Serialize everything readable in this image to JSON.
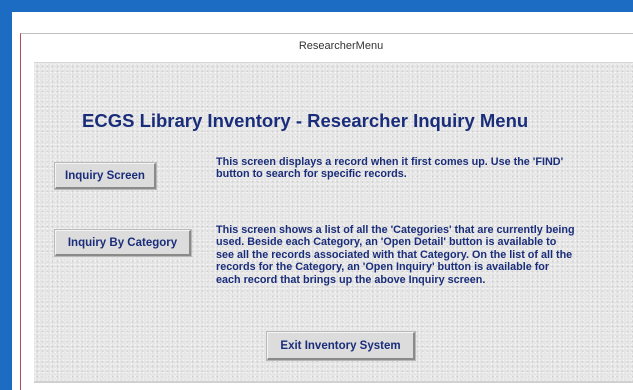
{
  "window": {
    "title": "ResearcherMenu"
  },
  "form": {
    "heading": "ECGS Library Inventory - Researcher Inquiry Menu",
    "buttons": {
      "inquiry_screen": "Inquiry Screen",
      "inquiry_by_category": "Inquiry By Category",
      "exit": "Exit Inventory System"
    },
    "descriptions": {
      "inquiry_screen": "This screen displays a record when it first comes up.  Use the 'FIND' button to search for specific records.",
      "inquiry_by_category": "This screen shows a list of all the 'Categories' that are currently being used.  Beside each Category, an 'Open Detail' button is available to see all the records associated with that Category.  On the list of all the records for the Category, an 'Open Inquiry' button is available for each record that brings up the above Inquiry screen."
    }
  },
  "colors": {
    "accent_bar": "#1c6cc4",
    "text": "#1a2d7a",
    "form_background": "#e4e4e4"
  }
}
